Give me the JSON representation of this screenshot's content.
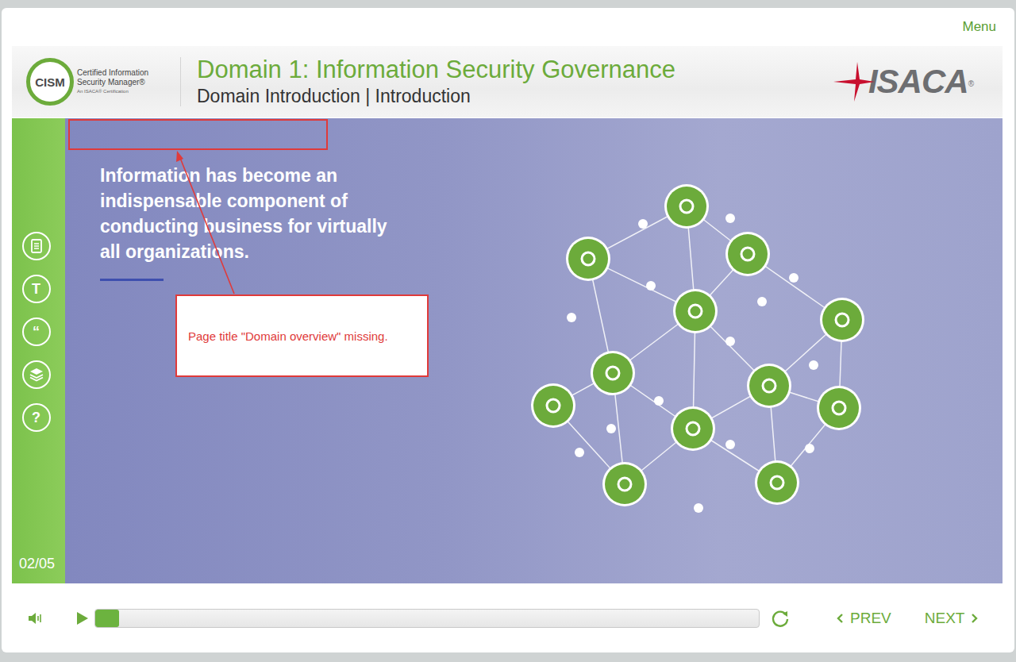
{
  "menu": "Menu",
  "logo": {
    "badge": "CISM",
    "lines": [
      "Certified Information",
      "Security Manager®"
    ],
    "tagline": "An ISACA® Certification"
  },
  "header": {
    "title": "Domain 1: Information Security Governance",
    "subtitle": "Domain Introduction | Introduction"
  },
  "brand": {
    "name": "ISACA",
    "mark": "®"
  },
  "sidebar": {
    "tools": [
      {
        "kind": "notes",
        "glyph": ""
      },
      {
        "kind": "glyph",
        "glyph": "T"
      },
      {
        "kind": "glyph",
        "glyph": "“"
      },
      {
        "kind": "layers",
        "glyph": ""
      },
      {
        "kind": "glyph",
        "glyph": "?"
      }
    ],
    "page_counter": "02/05"
  },
  "slide": {
    "text": "Information has become an indispensable component of conducting business for virtually all organizations."
  },
  "annotation": {
    "comment": "Page title \"Domain overview\" missing."
  },
  "player": {
    "muted": false,
    "playing": false,
    "level": 0.036,
    "prev": "PREV",
    "next": "NEXT"
  }
}
